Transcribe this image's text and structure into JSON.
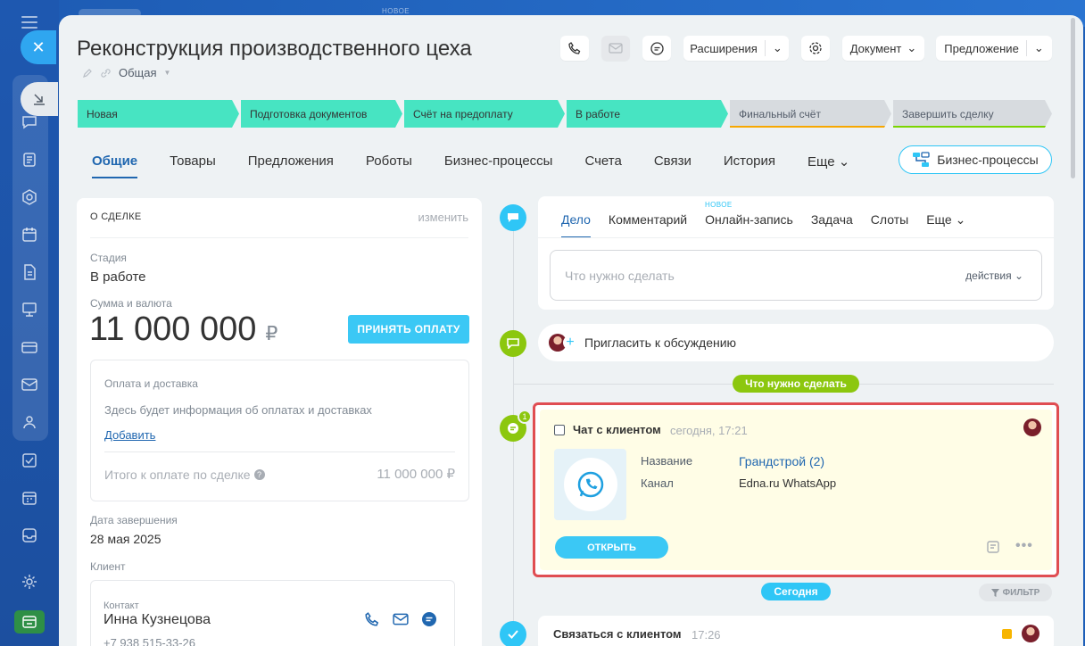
{
  "header": {
    "title": "Реконструкция производственного цеха",
    "category": "Общая",
    "extensions_label": "Расширения",
    "document_label": "Документ",
    "proposal_label": "Предложение",
    "top_badge": "НОВОЕ"
  },
  "stages": [
    {
      "label": "Новая",
      "state": "done"
    },
    {
      "label": "Подготовка документов",
      "state": "done"
    },
    {
      "label": "Счёт на предоплату",
      "state": "done"
    },
    {
      "label": "В работе",
      "state": "done"
    },
    {
      "label": "Финальный счёт",
      "state": "todo"
    },
    {
      "label": "Завершить сделку",
      "state": "todo"
    }
  ],
  "tabs": [
    "Общие",
    "Товары",
    "Предложения",
    "Роботы",
    "Бизнес-процессы",
    "Счета",
    "Связи",
    "История",
    "Еще"
  ],
  "business_process_button": "Бизнес-процессы",
  "deal": {
    "section_title": "О СДЕЛКЕ",
    "edit_link": "изменить",
    "stage_label": "Стадия",
    "stage_value": "В работе",
    "amount_label": "Сумма и валюта",
    "amount_value": "11 000 000",
    "currency": "₽",
    "pay_button": "ПРИНЯТЬ ОПЛАТУ",
    "payment_title": "Оплата и доставка",
    "payment_info": "Здесь будет информация об оплатах и доставках",
    "add_link": "Добавить",
    "total_label": "Итого к оплате по сделке",
    "total_value": "11 000 000 ₽",
    "close_date_label": "Дата завершения",
    "close_date_value": "28 мая 2025",
    "client_label": "Клиент",
    "contact_label": "Контакт",
    "contact_name": "Инна Кузнецова",
    "contact_phone": "+7 938 515-33-26"
  },
  "editor": {
    "tabs": [
      "Дело",
      "Комментарий",
      "Онлайн-запись",
      "Задача",
      "Слоты",
      "Еще"
    ],
    "new_badge": "НОВОЕ",
    "placeholder": "Что нужно сделать",
    "actions_label": "действия"
  },
  "invite_label": "Пригласить к обсуждению",
  "todo_pill": "Что нужно сделать",
  "activity": {
    "badge_count": "1",
    "title": "Чат с клиентом",
    "time": "сегодня, 17:21",
    "name_label": "Название",
    "name_value": "Грандстрой (2)",
    "channel_label": "Канал",
    "channel_value": "Edna.ru WhatsApp",
    "open_button": "ОТКРЫТЬ"
  },
  "today_pill": "Сегодня",
  "filter_label": "ФИЛЬТР",
  "bottom_activity": {
    "title": "Связаться с клиентом",
    "time": "17:26"
  },
  "colors": {
    "stage_done": "#47e4c2",
    "accent_blue": "#2067b0",
    "button_blue": "#3bc8f5",
    "timeline_green": "#8cc70e",
    "highlight_red": "#e04d52"
  }
}
